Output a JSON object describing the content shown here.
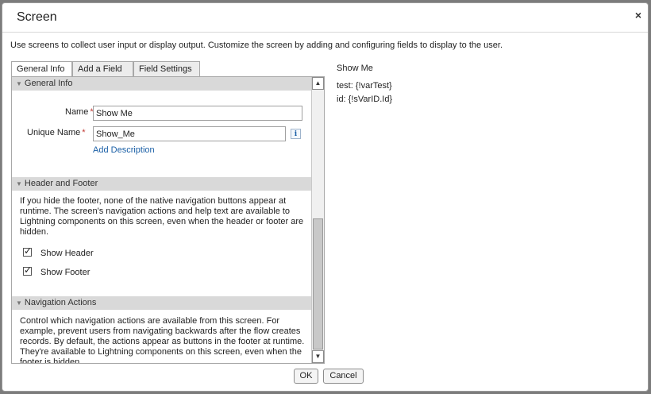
{
  "dialog": {
    "title": "Screen",
    "close_glyph": "×",
    "intro": "Use screens to collect user input or display output. Customize the screen by adding and configuring fields to display to the user."
  },
  "tabs": [
    {
      "label": "General Info",
      "active": true
    },
    {
      "label": "Add a Field",
      "active": false
    },
    {
      "label": "Field Settings",
      "active": false
    }
  ],
  "general_info": {
    "header": "General Info",
    "name_label": "Name",
    "name_value": "Show Me",
    "unique_name_label": "Unique Name",
    "unique_name_value": "Show_Me",
    "required_marker": "*",
    "info_glyph": "i",
    "add_description": "Add Description"
  },
  "header_footer": {
    "header": "Header and Footer",
    "description": "If you hide the footer, none of the native navigation buttons appear at runtime. The screen's navigation actions and help text are available to Lightning components on this screen, even when the header or footer are hidden.",
    "show_header": {
      "label": "Show Header",
      "checked": true
    },
    "show_footer": {
      "label": "Show Footer",
      "checked": true
    },
    "check_glyph": "✓"
  },
  "navigation_actions": {
    "header": "Navigation Actions",
    "description": "Control which navigation actions are available from this screen. For example, prevent users from navigating backwards after the flow creates records. By default, the actions appear as buttons in the footer at runtime. They're available to Lightning components on this screen, even when the footer is hidden."
  },
  "section_glyph": "▼",
  "scrollbar": {
    "up_glyph": "▲",
    "down_glyph": "▼"
  },
  "preview": {
    "title": "Show Me",
    "lines": [
      "test: {!varTest}",
      "id: {!sVarID.Id}"
    ]
  },
  "footer": {
    "ok_label": "OK",
    "cancel_label": "Cancel"
  }
}
